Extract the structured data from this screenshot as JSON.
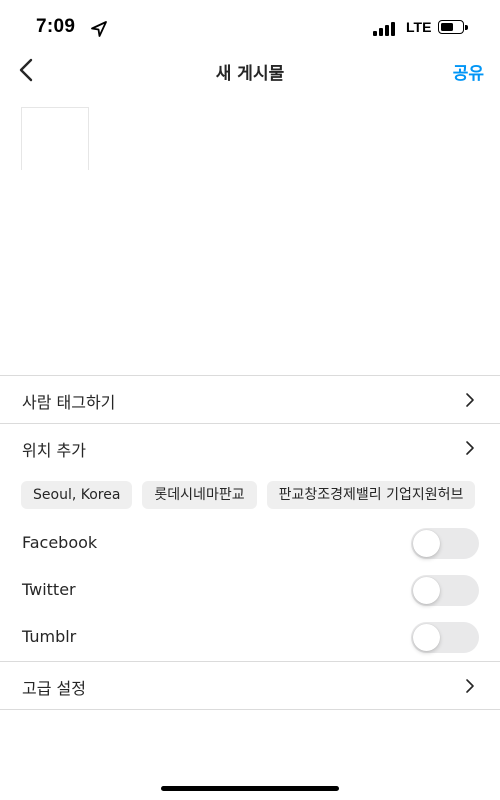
{
  "status_bar": {
    "time": "7:09",
    "network": "LTE",
    "battery_level": 0.6,
    "signal_bars": 4
  },
  "header": {
    "title": "새 게시물",
    "share_label": "공유"
  },
  "options": {
    "tag_people": "사람 태그하기",
    "add_location": "위치 추가"
  },
  "location_suggestions": [
    "Seoul, Korea",
    "롯데시네마판교",
    "판교창조경제밸리 기업지원허브"
  ],
  "social": [
    {
      "label": "Facebook",
      "enabled": false
    },
    {
      "label": "Twitter",
      "enabled": false
    },
    {
      "label": "Tumblr",
      "enabled": false
    }
  ],
  "advanced": {
    "label": "고급 설정"
  },
  "colors": {
    "accent": "#0095f6",
    "divider": "#dbdbdb",
    "chip_bg": "#efefef",
    "toggle_off": "#e9e9ea"
  }
}
